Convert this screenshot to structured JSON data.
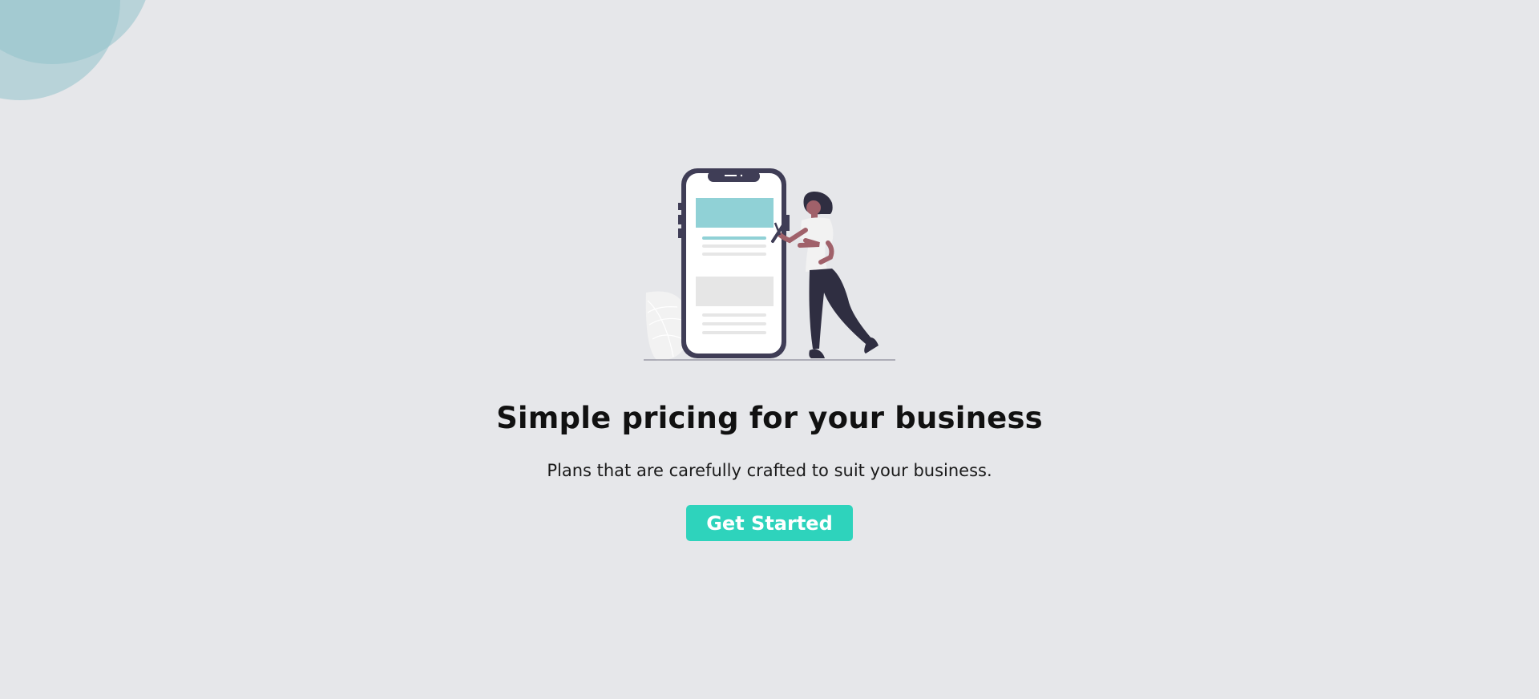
{
  "hero": {
    "headline": "Simple pricing for your business",
    "subheadline": "Plans that are carefully crafted to suit your business.",
    "cta_label": "Get Started"
  },
  "colors": {
    "background": "#e6e7ea",
    "accent": "#2ed3bc",
    "decor_circle": "#91c3ca",
    "phone_frame": "#3f3d56",
    "phone_highlight": "#90d1d6"
  },
  "illustration": {
    "icon": "woman-with-phone-illustration"
  }
}
